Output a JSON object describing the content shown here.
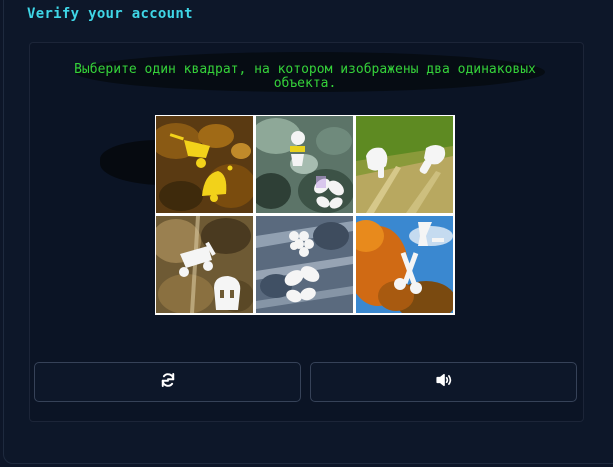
{
  "header": {
    "title": "Verify your account"
  },
  "challenge": {
    "instruction": "Выберите один квадрат, на котором изображены два одинаковых объекта."
  },
  "tiles": [
    {
      "icons": [
        "wheelbarrow-icon",
        "bell-icon"
      ]
    },
    {
      "icons": [
        "pawn-icon",
        "butterfly-icon"
      ]
    },
    {
      "icons": [
        "hair-dryer-icon",
        "hair-dryer-icon"
      ]
    },
    {
      "icons": [
        "lawnmower-icon",
        "mask-icon"
      ]
    },
    {
      "icons": [
        "grapes-icon",
        "butterfly-icon"
      ]
    },
    {
      "icons": [
        "spray-bottle-icon",
        "scissors-icon"
      ]
    }
  ],
  "buttons": {
    "refresh_icon": "refresh-icon",
    "audio_icon": "speaker-icon"
  },
  "colors": {
    "title": "#3fd6e6",
    "instruction": "#35d23a",
    "background": "#0d1628"
  }
}
